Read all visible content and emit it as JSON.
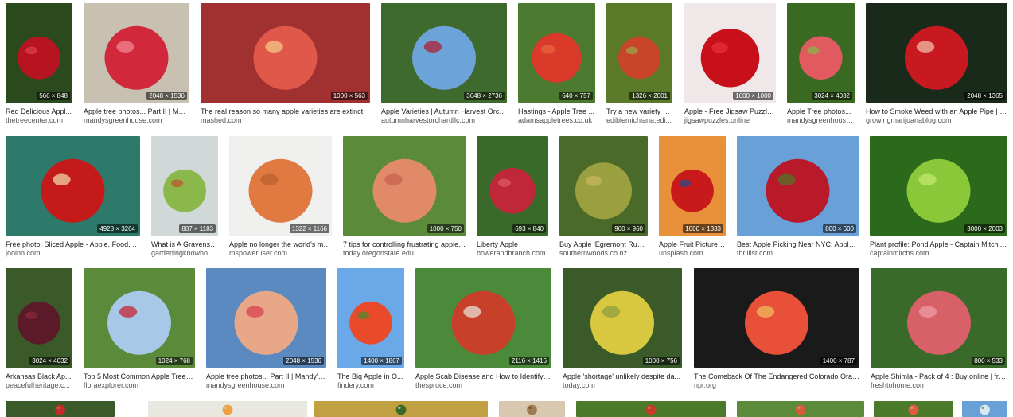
{
  "results": [
    {
      "caption": "Red Delicious Appl...",
      "source": "thetreecenter.com",
      "dims": "566 × 848",
      "palette": [
        "#2a4a1e",
        "#b51420",
        "#e04050"
      ]
    },
    {
      "caption": "Apple tree photos... Part II | Man...",
      "source": "mandysgreenhouse.com",
      "dims": "2048 × 1536",
      "palette": [
        "#c8c0b0",
        "#d2283c",
        "#f28a96"
      ]
    },
    {
      "caption": "The real reason so many apple varieties are extinct",
      "source": "mashed.com",
      "dims": "1000 × 563",
      "palette": [
        "#a13030",
        "#e0584a",
        "#f4d08a"
      ]
    },
    {
      "caption": "Apple Varieties | Autumn Harvest Orch...",
      "source": "autumnharvestorchardllc.com",
      "dims": "3648 × 2736",
      "palette": [
        "#3f6a2e",
        "#6ca3d8",
        "#b21828"
      ]
    },
    {
      "caption": "Hastings - Apple Tree ...",
      "source": "adamsappletrees.co.uk",
      "dims": "640 × 757",
      "palette": [
        "#4b7a30",
        "#d93a2a",
        "#e86840"
      ]
    },
    {
      "caption": "Try a new variety o...",
      "source": "ediblemichiana.edi...",
      "dims": "1326 × 2001",
      "palette": [
        "#5a7a2a",
        "#c8452a",
        "#9aa84a"
      ]
    },
    {
      "caption": "Apple - Free Jigsaw Puzzles...",
      "source": "jigsawpuzzles.online",
      "dims": "1000 × 1000",
      "palette": [
        "#f0e8e8",
        "#c8101a",
        "#e83040"
      ]
    },
    {
      "caption": "Apple Tree photos...",
      "source": "mandysgreenhouse...",
      "dims": "3024 × 4032",
      "palette": [
        "#3a6a22",
        "#e05a60",
        "#88b84a"
      ]
    },
    {
      "caption": "How to Smoke Weed with an Apple Pipe | Gr...",
      "source": "growingmarijuanablog.com",
      "dims": "2048 × 1365",
      "palette": [
        "#1a2a1a",
        "#c81820",
        "#f2c8b0"
      ]
    },
    {
      "caption": "Free photo: Sliced Apple - Apple, Food, Fr...",
      "source": "jooinn.com",
      "dims": "4928 × 3264",
      "palette": [
        "#2e7a6a",
        "#c41a1a",
        "#f4e0b0"
      ]
    },
    {
      "caption": "What is A Gravenst...",
      "source": "gardeningknowho...",
      "dims": "887 × 1183",
      "palette": [
        "#d0d8d8",
        "#8ab84a",
        "#c0502a"
      ]
    },
    {
      "caption": "Apple no longer the world's mo...",
      "source": "mspoweruser.com",
      "dims": "1322 × 1166",
      "palette": [
        "#f0f0ee",
        "#e07a40",
        "#b86030"
      ]
    },
    {
      "caption": "7 tips for controlling frustrating apple ...",
      "source": "today.oregonstate.edu",
      "dims": "1000 × 750",
      "palette": [
        "#5a8a3a",
        "#e08a6a",
        "#c86050"
      ]
    },
    {
      "caption": "Liberty Apple",
      "source": "bowerandbranch.com",
      "dims": "693 × 840",
      "palette": [
        "#3a6a2a",
        "#c0283a",
        "#e05a6a"
      ]
    },
    {
      "caption": "Buy Apple 'Egremont Russ...",
      "source": "southernwoods.co.nz",
      "dims": "960 × 960",
      "palette": [
        "#4a6a2a",
        "#9aa040",
        "#c8b860"
      ]
    },
    {
      "caption": "Apple Fruit Pictures...",
      "source": "unsplash.com",
      "dims": "1000 × 1333",
      "palette": [
        "#e8903a",
        "#c81a1a",
        "#2a4a8a"
      ]
    },
    {
      "caption": "Best Apple Picking Near NYC: Apple ...",
      "source": "thrillist.com",
      "dims": "800 × 600",
      "palette": [
        "#6aa0d8",
        "#b81a2a",
        "#4a7a2a"
      ]
    },
    {
      "caption": "Plant profile: Pond Apple - Captain Mitch's ...",
      "source": "captainmitchs.com",
      "dims": "3000 × 2003",
      "palette": [
        "#2a6a1a",
        "#8ac83a",
        "#c8e870"
      ]
    },
    {
      "caption": "Arkansas Black Ap...",
      "source": "peacefulheritage.c...",
      "dims": "3024 × 4032",
      "palette": [
        "#3a5a2a",
        "#5a1a2a",
        "#8a2a3a"
      ]
    },
    {
      "caption": "Top 5 Most Common Apple Tree D...",
      "source": "floraexplorer.com",
      "dims": "1024 × 768",
      "palette": [
        "#5a8a3a",
        "#a8c8e8",
        "#c81a2a"
      ]
    },
    {
      "caption": "Apple tree photos... Part II | Mandy's ...",
      "source": "mandysgreenhouse.com",
      "dims": "2048 × 1536",
      "palette": [
        "#5a8ac0",
        "#e8a888",
        "#d83a4a"
      ]
    },
    {
      "caption": "The Big Apple in O...",
      "source": "findery.com",
      "dims": "1400 × 1867",
      "palette": [
        "#6aa8e8",
        "#e84a2a",
        "#4a8a2a"
      ]
    },
    {
      "caption": "Apple Scab Disease and How to Identify a...",
      "source": "thespruce.com",
      "dims": "2116 × 1416",
      "palette": [
        "#4a8a3a",
        "#c8402a",
        "#e8e8e0"
      ]
    },
    {
      "caption": "Apple 'shortage' unlikely despite da...",
      "source": "today.com",
      "dims": "1000 × 756",
      "palette": [
        "#3a5a2a",
        "#d8c840",
        "#8a9a3a"
      ]
    },
    {
      "caption": "The Comeback Of The Endangered Colorado Oran...",
      "source": "npr.org",
      "dims": "1400 × 787",
      "palette": [
        "#1a1a1a",
        "#e8503a",
        "#f0c060"
      ]
    },
    {
      "caption": "Apple Shimla - Pack of 4 : Buy online | fres...",
      "source": "freshtohome.com",
      "dims": "800 × 533",
      "palette": [
        "#3a6a2a",
        "#d86068",
        "#f0a0a8"
      ]
    },
    {
      "caption": "",
      "source": "",
      "dims": "",
      "palette": [
        "#3a5a2a",
        "#c8282a",
        "#7a9a4a"
      ]
    },
    {
      "caption": "",
      "source": "",
      "dims": "",
      "palette": [
        "#e8e8e0",
        "#f0a040",
        "#c8c8c0"
      ]
    },
    {
      "caption": "",
      "source": "",
      "dims": "",
      "palette": [
        "#c0a040",
        "#3a6a2a",
        "#e8d8a0"
      ]
    },
    {
      "caption": "",
      "source": "",
      "dims": "",
      "palette": [
        "#d8c8b0",
        "#a07a50",
        "#5a4a30"
      ]
    },
    {
      "caption": "",
      "source": "",
      "dims": "",
      "palette": [
        "#4a7a2a",
        "#c83a2a",
        "#90b060"
      ]
    },
    {
      "caption": "",
      "source": "",
      "dims": "",
      "palette": [
        "#5a8a3a",
        "#d85a3a",
        "#a0c070"
      ]
    },
    {
      "caption": "",
      "source": "",
      "dims": "",
      "palette": [
        "#4a7a2a",
        "#e05a40",
        "#b0d070"
      ]
    },
    {
      "caption": "",
      "source": "",
      "dims": "",
      "palette": [
        "#6aa0d8",
        "#d8e8f0",
        "#4a7a2a"
      ]
    }
  ]
}
